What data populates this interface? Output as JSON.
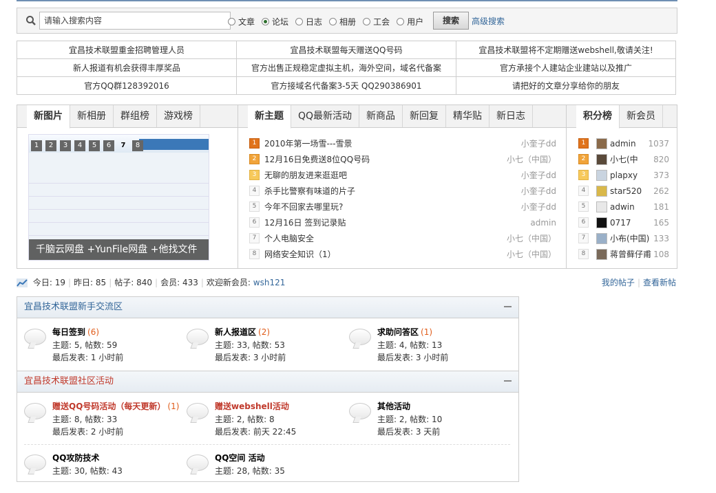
{
  "search": {
    "placeholder": "请输入搜索内容",
    "options": [
      {
        "label": "文章",
        "checked": false
      },
      {
        "label": "论坛",
        "checked": true
      },
      {
        "label": "日志",
        "checked": false
      },
      {
        "label": "相册",
        "checked": false
      },
      {
        "label": "工会",
        "checked": false
      },
      {
        "label": "用户",
        "checked": false
      }
    ],
    "button": "搜索",
    "advanced": "高级搜索"
  },
  "notices": [
    [
      "宜昌技术联盟重金招聘管理人员",
      "宜昌技术联盟每天赠送QQ号码",
      "宜昌技术联盟将不定期赠送webshell,敬请关注!"
    ],
    [
      "新人报道有机会获得丰厚奖品",
      "官方出售正规稳定虚拟主机，海外空间，域名代备案",
      "官方承接个人建站企业建站以及推广"
    ],
    [
      "官方QQ群128392016",
      "官方接域名代备案3-5天 QQ290386901",
      "请把好的文章分享给你的朋友"
    ]
  ],
  "panel_left": {
    "tabs": [
      "新图片",
      "新相册",
      "群组榜",
      "游戏榜"
    ],
    "slider_pages": [
      "1",
      "2",
      "3",
      "4",
      "5",
      "6",
      "7",
      "8"
    ],
    "slider_current": "7",
    "caption": "千脑云网盘 +YunFile网盘 +他找文件"
  },
  "panel_mid": {
    "tabs": [
      "新主题",
      "QQ最新活动",
      "新商品",
      "新回复",
      "精华贴",
      "新日志"
    ],
    "threads": [
      {
        "n": "1",
        "title": "2010年第一场雪---雪景",
        "user": "小奎子dd"
      },
      {
        "n": "2",
        "title": "12月16日免费送8位QQ号码",
        "user": "小七（中国）"
      },
      {
        "n": "3",
        "title": "无聊的朋友进来逛逛吧",
        "user": "小奎子dd"
      },
      {
        "n": "4",
        "title": "杀手比警察有味道的片子",
        "user": "小奎子dd"
      },
      {
        "n": "5",
        "title": "今年不回家去哪里玩?",
        "user": "小奎子dd"
      },
      {
        "n": "6",
        "title": "12月16日 签到记录贴",
        "user": "admin"
      },
      {
        "n": "7",
        "title": "个人电脑安全",
        "user": "小七（中国）"
      },
      {
        "n": "8",
        "title": "网络安全知识（1）",
        "user": "小七（中国）"
      }
    ]
  },
  "panel_right": {
    "tabs": [
      "积分榜",
      "新会员"
    ],
    "ranks": [
      {
        "n": "1",
        "name": "admin",
        "score": "1037",
        "avatar_color": "#8a6a4a"
      },
      {
        "n": "2",
        "name": "小七(中",
        "score": "820",
        "avatar_color": "#5a4a3a"
      },
      {
        "n": "3",
        "name": "plapxy",
        "score": "373",
        "avatar_color": "#c9d4e0"
      },
      {
        "n": "4",
        "name": "star520",
        "score": "262",
        "avatar_color": "#d9b84a"
      },
      {
        "n": "5",
        "name": "adwin",
        "score": "181",
        "avatar_color": "#e8e8e8"
      },
      {
        "n": "6",
        "name": "0717",
        "score": "165",
        "avatar_color": "#111111"
      },
      {
        "n": "7",
        "name": "小布(中国)",
        "score": "133",
        "avatar_color": "#9ab0c8"
      },
      {
        "n": "8",
        "name": "蒋曾藓仔甫",
        "score": "108",
        "avatar_color": "#7a6a5a"
      }
    ]
  },
  "stats": {
    "today_label": "今日:",
    "today": "19",
    "yesterday_label": "昨日:",
    "yesterday": "85",
    "posts_label": "帖子:",
    "posts": "840",
    "members_label": "会员:",
    "members": "433",
    "welcome": "欢迎新会员:",
    "new_member": "wsh121",
    "my_posts": "我的帖子",
    "new_posts": "查看新帖"
  },
  "sections": [
    {
      "title": "宜昌技术联盟新手交流区",
      "forums": [
        {
          "name": "每日签到",
          "count": "(6)",
          "stats": "主题: 5, 帖数: 59",
          "last": "最后发表: 1 小时前",
          "red": false
        },
        {
          "name": "新人报道区",
          "count": "(2)",
          "stats": "主题: 33, 帖数: 53",
          "last": "最后发表: 3 小时前",
          "red": false
        },
        {
          "name": "求助问答区",
          "count": "(1)",
          "stats": "主题: 4, 帖数: 13",
          "last": "最后发表: 3 小时前",
          "red": false
        }
      ]
    },
    {
      "title": "宜昌技术联盟社区活动",
      "forums": [
        {
          "name": "赠送QQ号码活动（每天更新）",
          "count": "(1)",
          "stats": "主题: 8, 帖数: 33",
          "last": "最后发表: 2 小时前",
          "red": true
        },
        {
          "name": "赠送webshell活动",
          "count": "",
          "stats": "主题: 2, 帖数: 8",
          "last": "最后发表: 前天 22:45",
          "red": true
        },
        {
          "name": "其他活动",
          "count": "",
          "stats": "主题: 2, 帖数: 10",
          "last": "最后发表: 3 天前",
          "red": false
        },
        {
          "name": "QQ攻防技术",
          "count": "",
          "stats": "主题: 30, 帖数: 43",
          "last": "",
          "red": false
        },
        {
          "name": "QQ空间 活动",
          "count": "",
          "stats": "主题: 28, 帖数: 35",
          "last": "",
          "red": false
        }
      ]
    }
  ]
}
